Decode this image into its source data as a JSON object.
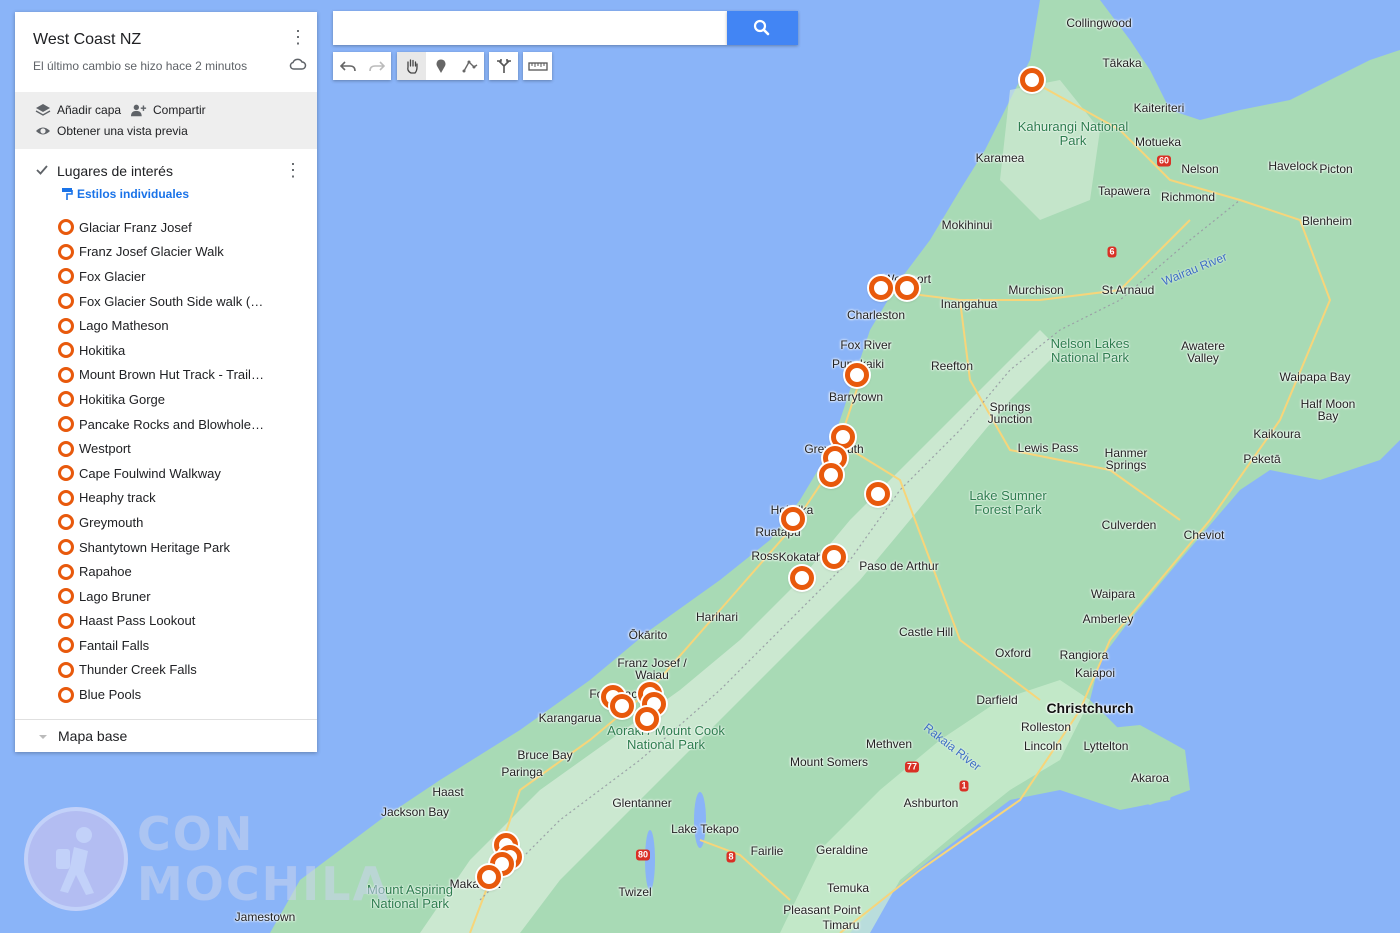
{
  "map_title": "West Coast NZ",
  "last_change": "El último cambio se hizo hace 2 minutos",
  "actions": {
    "add_layer": "Añadir capa",
    "share": "Compartir",
    "preview": "Obtener una vista previa"
  },
  "layer": {
    "title": "Lugares de interés",
    "style_link": "Estilos individuales",
    "items": [
      "Glaciar Franz Josef",
      "Franz Josef Glacier Walk",
      "Fox Glacier",
      "Fox Glacier South Side walk (…",
      "Lago Matheson",
      "Hokitika",
      "Mount Brown Hut Track - Trail…",
      "Hokitika Gorge",
      "Pancake Rocks and Blowhole…",
      "Westport",
      "Cape Foulwind Walkway",
      "Heaphy track",
      "Greymouth",
      "Shantytown Heritage Park",
      "Rapahoe",
      "Lago Bruner",
      "Haast Pass Lookout",
      "Fantail Falls",
      "Thunder Creek Falls",
      "Blue Pools"
    ]
  },
  "base_map": "Mapa base",
  "search": {
    "placeholder": ""
  },
  "toolbar": [
    "undo-icon",
    "redo-icon",
    "hand-icon",
    "marker-icon",
    "line-icon",
    "directions-icon",
    "ruler-icon"
  ],
  "watermark": {
    "line1": "CON",
    "line2": "MOCHILA"
  },
  "colors": {
    "water": "#8ab4f8",
    "land": "#a8dab5",
    "mountain": "#d7ecd9",
    "marker": "#e8590c",
    "search_button": "#4285f4"
  },
  "places": [
    {
      "name": "Collingwood"
    },
    {
      "name": "Tākaka"
    },
    {
      "name": "Kaiteriteri"
    },
    {
      "name": "Motueka"
    },
    {
      "name": "Karamea"
    },
    {
      "name": "Nelson"
    },
    {
      "name": "Havelock"
    },
    {
      "name": "Picton"
    },
    {
      "name": "Tapawera"
    },
    {
      "name": "Richmond"
    },
    {
      "name": "Mokihinui"
    },
    {
      "name": "Blenheim"
    },
    {
      "name": "Westport"
    },
    {
      "name": "Inangahua"
    },
    {
      "name": "Murchison"
    },
    {
      "name": "St Arnaud"
    },
    {
      "name": "Charleston"
    },
    {
      "name": "Fox River"
    },
    {
      "name": "Punakaiki"
    },
    {
      "name": "Reefton"
    },
    {
      "name": "Awatere Valley"
    },
    {
      "name": "Waipapa Bay"
    },
    {
      "name": "Barrytown"
    },
    {
      "name": "Springs Junction"
    },
    {
      "name": "Half Moon Bay"
    },
    {
      "name": "Kaikoura"
    },
    {
      "name": "Greymouth"
    },
    {
      "name": "Lewis Pass"
    },
    {
      "name": "Hanmer Springs"
    },
    {
      "name": "Peketā"
    },
    {
      "name": "Hokitika"
    },
    {
      "name": "Ruatapu"
    },
    {
      "name": "Culverden"
    },
    {
      "name": "Cheviot"
    },
    {
      "name": "Ross"
    },
    {
      "name": "Kokatahi"
    },
    {
      "name": "Paso de Arthur"
    },
    {
      "name": "Waipara"
    },
    {
      "name": "Amberley"
    },
    {
      "name": "Harihari"
    },
    {
      "name": "Castle Hill"
    },
    {
      "name": "Ōkārito"
    },
    {
      "name": "Oxford"
    },
    {
      "name": "Rangiora"
    },
    {
      "name": "Franz Josef / Waiau"
    },
    {
      "name": "Kaiapoi"
    },
    {
      "name": "Fox Glacier"
    },
    {
      "name": "Darfield"
    },
    {
      "name": "Karangarua"
    },
    {
      "name": "Christchurch"
    },
    {
      "name": "Rolleston"
    },
    {
      "name": "Methven"
    },
    {
      "name": "Lincoln"
    },
    {
      "name": "Lyttelton"
    },
    {
      "name": "Bruce Bay"
    },
    {
      "name": "Paringa"
    },
    {
      "name": "Mount Somers"
    },
    {
      "name": "Akaroa"
    },
    {
      "name": "Haast"
    },
    {
      "name": "Ashburton"
    },
    {
      "name": "Glentanner"
    },
    {
      "name": "Jackson Bay"
    },
    {
      "name": "Lake Tekapo"
    },
    {
      "name": "Fairlie"
    },
    {
      "name": "Geraldine"
    },
    {
      "name": "Makarora"
    },
    {
      "name": "Temuka"
    },
    {
      "name": "Twizel"
    },
    {
      "name": "Pleasant Point"
    },
    {
      "name": "Timaru"
    },
    {
      "name": "Jamestown"
    }
  ],
  "parks": [
    {
      "name": "Kahurangi National Park"
    },
    {
      "name": "Nelson Lakes National Park"
    },
    {
      "name": "Lake Sumner Forest Park"
    },
    {
      "name": "Aoraki / Mount Cook National Park"
    },
    {
      "name": "Mount Aspiring National Park"
    }
  ],
  "rivers": [
    {
      "name": "Wairau River"
    },
    {
      "name": "Rakaia River"
    }
  ],
  "highways": [
    "60",
    "6",
    "80",
    "8",
    "77",
    "1"
  ]
}
